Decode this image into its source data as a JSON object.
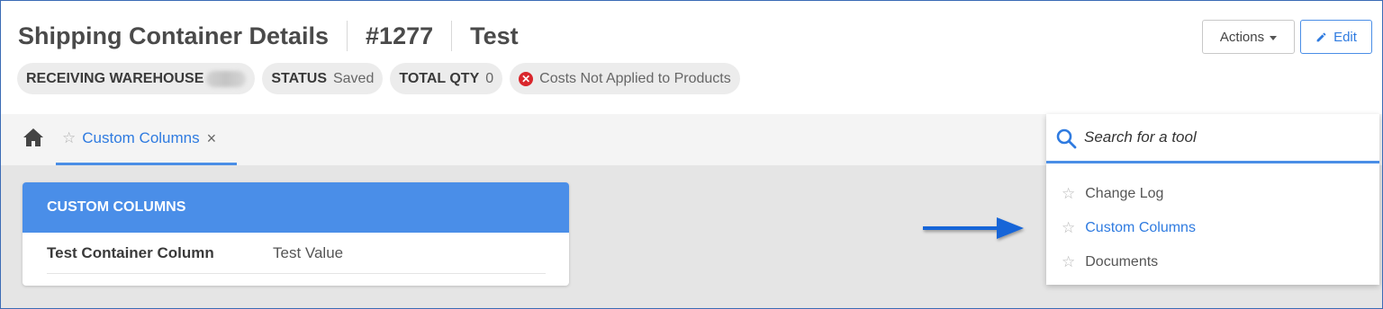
{
  "header": {
    "title": "Shipping Container Details",
    "number": "#1277",
    "name": "Test"
  },
  "chips": {
    "warehouse_label": "RECEIVING WAREHOUSE",
    "status_label": "STATUS",
    "status_value": "Saved",
    "qty_label": "TOTAL QTY",
    "qty_value": "0",
    "warning_text": "Costs Not Applied to Products"
  },
  "buttons": {
    "actions_label": "Actions",
    "edit_label": "Edit"
  },
  "tabs": [
    {
      "label": "Custom Columns",
      "close": "×"
    }
  ],
  "card": {
    "title": "CUSTOM COLUMNS",
    "rows": [
      {
        "key": "Test Container Column",
        "value": "Test Value"
      }
    ]
  },
  "tool_search": {
    "placeholder": "Search for a tool",
    "items": [
      {
        "label": "Change Log",
        "active": false
      },
      {
        "label": "Custom Columns",
        "active": true
      },
      {
        "label": "Documents",
        "active": false
      }
    ]
  },
  "colors": {
    "accent": "#4a8ee6",
    "link": "#2f7be0",
    "error": "#d9262c",
    "arrow": "#1565d8"
  },
  "icons": {
    "home": "home-icon",
    "star": "star-outline-icon",
    "close": "close-icon",
    "search": "search-icon",
    "pencil": "pencil-icon",
    "warning": "error-circle-icon",
    "arrow": "arrow-right-icon"
  }
}
